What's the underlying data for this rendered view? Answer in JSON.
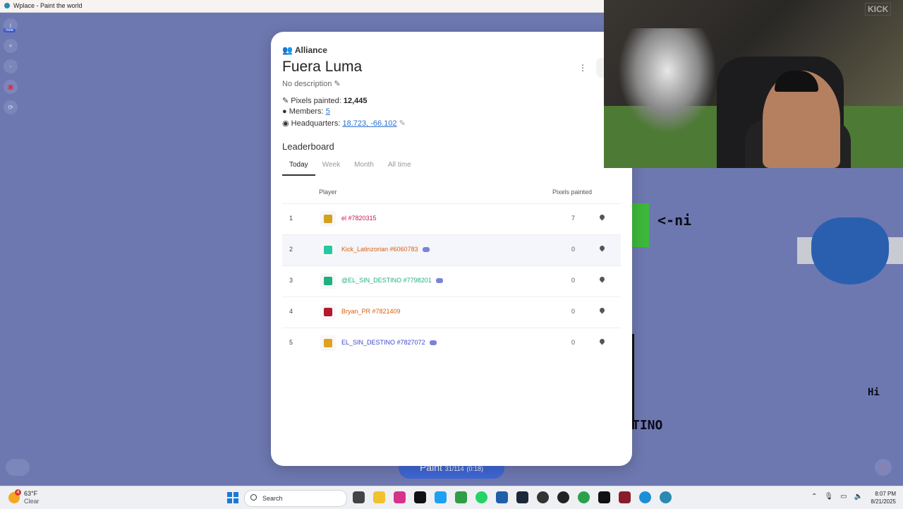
{
  "window": {
    "title": "Wplace - Paint the world"
  },
  "left_tools": {
    "info": "i",
    "new_badge": "new",
    "zoom_in": "+",
    "zoom_out": "-",
    "refresh": "⟳"
  },
  "alliance": {
    "kicker": "Alliance",
    "name": "Fuera Luma",
    "description": "No description",
    "pixels_label": "Pixels painted:",
    "pixels_value": "12,445",
    "members_label": "Members:",
    "members_value": "5",
    "hq_label": "Headquarters:",
    "hq_value": "18.723, -66.102",
    "menu": "⋮"
  },
  "leaderboard": {
    "title": "Leaderboard",
    "tabs": [
      "Today",
      "Week",
      "Month",
      "All time"
    ],
    "col_player": "Player",
    "col_pixels": "Pixels painted",
    "rows": [
      {
        "rank": "1",
        "name": "el #7820315",
        "count": "7",
        "color": "#c2185b",
        "avatar": "#d4a020",
        "discord": false
      },
      {
        "rank": "2",
        "name": "Kick_Latinzorian #6060783",
        "count": "0",
        "color": "#d9600e",
        "avatar": "#23c9a3",
        "discord": true
      },
      {
        "rank": "3",
        "name": "@EL_SIN_DESTINO #7798201",
        "count": "0",
        "color": "#20b07e",
        "avatar": "#20b07e",
        "discord": true
      },
      {
        "rank": "4",
        "name": "Bryan_PR #7821409",
        "count": "0",
        "color": "#d9600e",
        "avatar": "#b01a2a",
        "discord": false
      },
      {
        "rank": "5",
        "name": "EL_SIN_DESTINO #7827072",
        "count": "0",
        "color": "#3b49c9",
        "avatar": "#e0a020",
        "discord": true
      }
    ]
  },
  "paint_button": {
    "label": "Paint",
    "counter": "31/114",
    "extra": "(0:18)"
  },
  "map_art": {
    "arrow_text": "<-ni",
    "hi_text": "Hi",
    "tino_text": "TINO"
  },
  "stream": {
    "logo": "KICK"
  },
  "taskbar": {
    "weather_temp": "63°F",
    "weather_cond": "Clear",
    "weather_badge": "4",
    "search_label": "Search",
    "time": "8:07 PM",
    "date": "8/21/2025"
  },
  "colors": {
    "map": "#6e78b0",
    "accent": "#2c6fcf"
  }
}
